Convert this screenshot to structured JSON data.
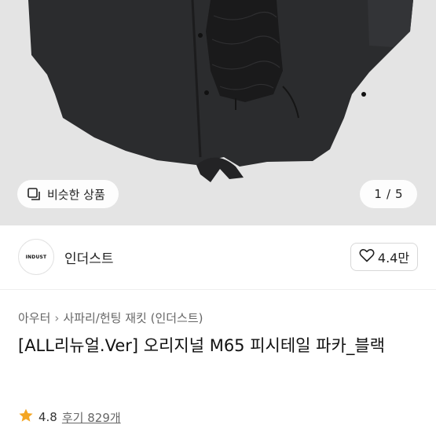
{
  "hero": {
    "similar_label": "비슷한 상품",
    "counter_current": "1",
    "counter_separator": "/",
    "counter_total": "5",
    "background_color": "#e4e4e4"
  },
  "seller": {
    "logo_text": "INDUST",
    "name": "인더스트",
    "follow_count": "4.4만"
  },
  "breadcrumb": {
    "category": "아우터",
    "subcategory": "사파리/헌팅 재킷 (인더스트)"
  },
  "product": {
    "title": "[ALL리뉴얼.Ver] 오리지널 M65 피시테일 파카_블랙"
  },
  "rating": {
    "score": "4.8",
    "reviews_label": "후기 829개",
    "star_color": "#f4a623"
  }
}
